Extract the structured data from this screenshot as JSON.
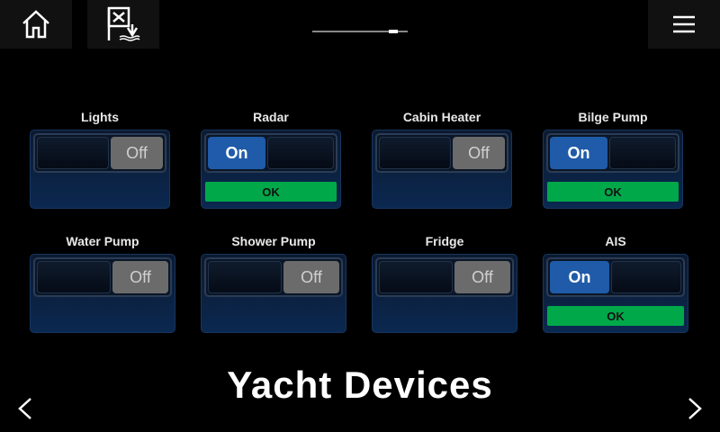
{
  "header": {
    "home_icon": "home-icon",
    "flag_icon": "anchor-flag-icon",
    "menu_icon": "hamburger-menu-icon"
  },
  "switches": [
    {
      "label": "Lights",
      "state": "Off",
      "status": ""
    },
    {
      "label": "Radar",
      "state": "On",
      "status": "OK"
    },
    {
      "label": "Cabin Heater",
      "state": "Off",
      "status": ""
    },
    {
      "label": "Bilge Pump",
      "state": "On",
      "status": "OK"
    },
    {
      "label": "Water Pump",
      "state": "Off",
      "status": ""
    },
    {
      "label": "Shower Pump",
      "state": "Off",
      "status": ""
    },
    {
      "label": "Fridge",
      "state": "Off",
      "status": ""
    },
    {
      "label": "AIS",
      "state": "On",
      "status": "OK"
    }
  ],
  "brand": {
    "text": "Yacht Devices"
  },
  "colors": {
    "on": "#1f5ba8",
    "off": "#6b6b6b",
    "ok": "#00a84a",
    "panel": "#0b2850"
  }
}
